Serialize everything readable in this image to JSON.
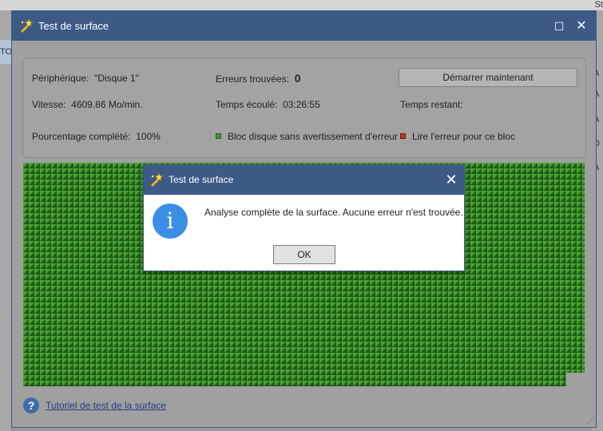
{
  "background": {
    "top_fragment": "St",
    "left_fragment": "TOS",
    "right_fragments": [
      "A",
      "A",
      "A",
      "D",
      "A"
    ]
  },
  "window": {
    "title": "Test de surface",
    "maximize_glyph": "☐",
    "close_glyph": "✕"
  },
  "info": {
    "device_label": "Périphérique:",
    "device_value": "\"Disque 1\"",
    "errors_label": "Erreurs trouvées:",
    "errors_value": "0",
    "start_button": "Démarrer maintenant",
    "speed_label": "Vitesse:",
    "speed_value": "4609.86 Mo/min.",
    "elapsed_label": "Temps écoulé:",
    "elapsed_value": "03:26:55",
    "remaining_label": "Temps restant:",
    "percent_label": "Pourcentage complété:",
    "percent_value": "100%",
    "legend_ok": "Bloc disque sans avertissement d'erreur",
    "legend_error": "Lire l'erreur pour ce bloc"
  },
  "colors": {
    "title_bar": "#3d5a87",
    "block_ok": "#3a9a2a",
    "block_error": "#c2331f",
    "info_icon": "#3a8ee6"
  },
  "help": {
    "link_text": "Tutoriel de test de la surface"
  },
  "dialog": {
    "title": "Test de surface",
    "close_glyph": "✕",
    "info_glyph": "i",
    "message": "Analyse complète de la surface. Aucune erreur n'est trouvée.",
    "ok_button": "OK"
  }
}
